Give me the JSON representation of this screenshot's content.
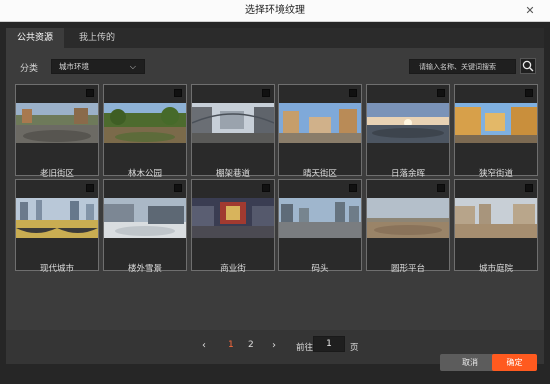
{
  "window": {
    "title": "选择环境纹理"
  },
  "tabs": [
    {
      "label": "公共资源",
      "active": true
    },
    {
      "label": "我上传的",
      "active": false
    }
  ],
  "filter": {
    "label": "分类",
    "selected": "城市环境"
  },
  "search": {
    "placeholder": "请输入名称、关键词搜索"
  },
  "textures": [
    {
      "name": "老旧街区",
      "thumb": "old-block"
    },
    {
      "name": "林木公园",
      "thumb": "park"
    },
    {
      "name": "棚架巷道",
      "thumb": "alley"
    },
    {
      "name": "晴天街区",
      "thumb": "sunny"
    },
    {
      "name": "日落余晖",
      "thumb": "sunset"
    },
    {
      "name": "狭窄街道",
      "thumb": "narrow"
    },
    {
      "name": "现代城市",
      "thumb": "modern"
    },
    {
      "name": "楼外雪景",
      "thumb": "snow"
    },
    {
      "name": "商业街",
      "thumb": "commercial"
    },
    {
      "name": "码头",
      "thumb": "dock"
    },
    {
      "name": "圆形平台",
      "thumb": "platform"
    },
    {
      "name": "城市庭院",
      "thumb": "courtyard"
    }
  ],
  "pagination": {
    "prev": "‹",
    "pages": [
      "1",
      "2"
    ],
    "current": "1",
    "next": "›",
    "goto_label": "前往",
    "goto_value": "1",
    "goto_suffix": "页"
  },
  "buttons": {
    "cancel": "取消",
    "confirm": "确定"
  },
  "colors": {
    "accent": "#ff6b3d",
    "confirm_bg": "#ff5a1f"
  }
}
